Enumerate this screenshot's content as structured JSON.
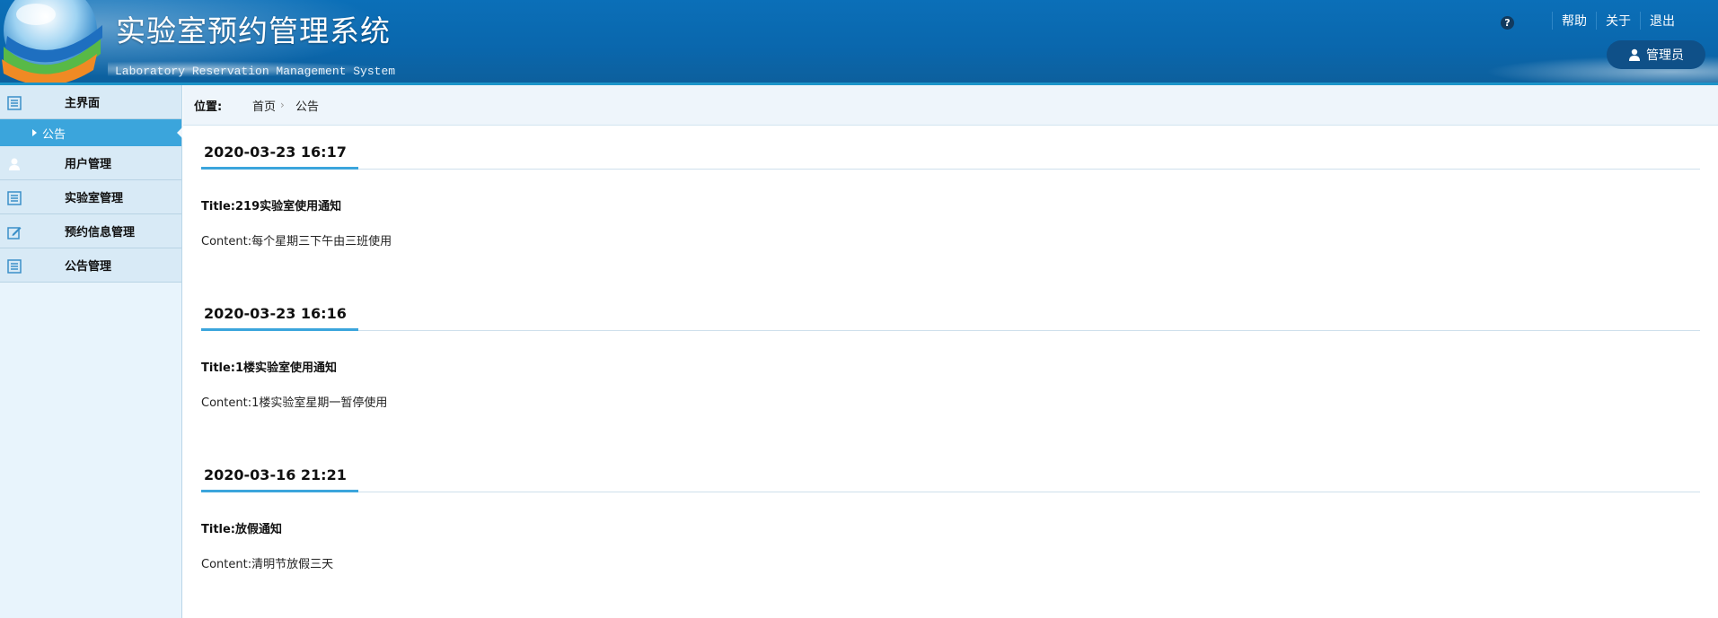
{
  "header": {
    "title": "实验室预约管理系统",
    "subtitle": "Laboratory Reservation Management System",
    "links": [
      "帮助",
      "关于",
      "退出"
    ],
    "help_icon": "?",
    "user": "管理员"
  },
  "sidebar": {
    "items": [
      {
        "label": "主界面",
        "icon": "list-icon"
      },
      {
        "label": "公告",
        "active": true
      },
      {
        "label": "用户管理",
        "icon": "user-icon"
      },
      {
        "label": "实验室管理",
        "icon": "list-icon"
      },
      {
        "label": "预约信息管理",
        "icon": "edit-icon"
      },
      {
        "label": "公告管理",
        "icon": "list-icon"
      }
    ]
  },
  "breadcrumb": {
    "label": "位置:",
    "home": "首页",
    "separator": "›",
    "current": "公告"
  },
  "notices": [
    {
      "date": "2020-03-23 16:17",
      "title": "Title:219实验室使用通知",
      "content": "Content:每个星期三下午由三班使用"
    },
    {
      "date": "2020-03-23 16:16",
      "title": "Title:1楼实验室使用通知",
      "content": "Content:1楼实验室星期一暂停使用"
    },
    {
      "date": "2020-03-16 21:21",
      "title": "Title:放假通知",
      "content": "Content:清明节放假三天"
    }
  ],
  "colors": {
    "header_blue": "#0a67ad",
    "active_menu": "#3ba5dc",
    "sidebar_bg": "#e8f4fc"
  }
}
